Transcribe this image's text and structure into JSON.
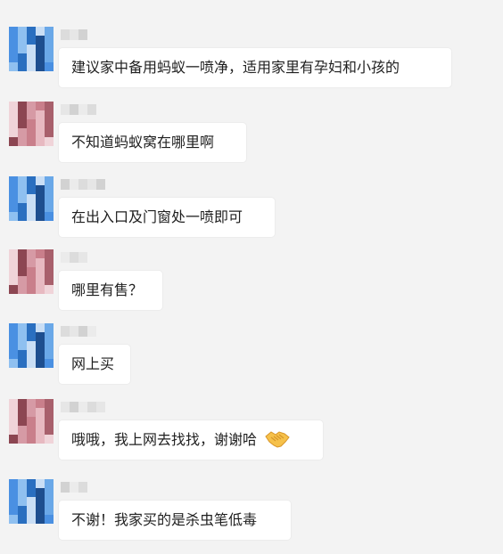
{
  "messages": [
    {
      "side": "left",
      "avatar": "blue",
      "text": "建议家中备用蚂蚁一喷净，适用家里有孕妇和小孩的"
    },
    {
      "side": "left",
      "avatar": "pink",
      "text": "不知道蚂蚁窝在哪里啊"
    },
    {
      "side": "left",
      "avatar": "blue",
      "text": "在出入口及门窗处一喷即可"
    },
    {
      "side": "left",
      "avatar": "pink",
      "text": "哪里有售？"
    },
    {
      "side": "left",
      "avatar": "blue",
      "text": "网上买"
    },
    {
      "side": "left",
      "avatar": "pink",
      "text": "哦哦，我上网去找找，谢谢哈",
      "emoji": "handshake-icon"
    },
    {
      "side": "left",
      "avatar": "blue",
      "text": "不谢！我家买的是杀虫笔低毒"
    }
  ],
  "colors": {
    "background": "#f3f3f3",
    "bubble": "#ffffff",
    "text": "#1f1f1f",
    "avatar_blue": [
      "#4a90e2",
      "#8fc0f0",
      "#2a6fc0",
      "#c9def5",
      "#1d4e8f",
      "#6aa8e8"
    ],
    "avatar_pink": [
      "#c97f8b",
      "#e7b9c1",
      "#a8606c",
      "#f0d4d9",
      "#8c4652",
      "#d69aa5"
    ]
  }
}
